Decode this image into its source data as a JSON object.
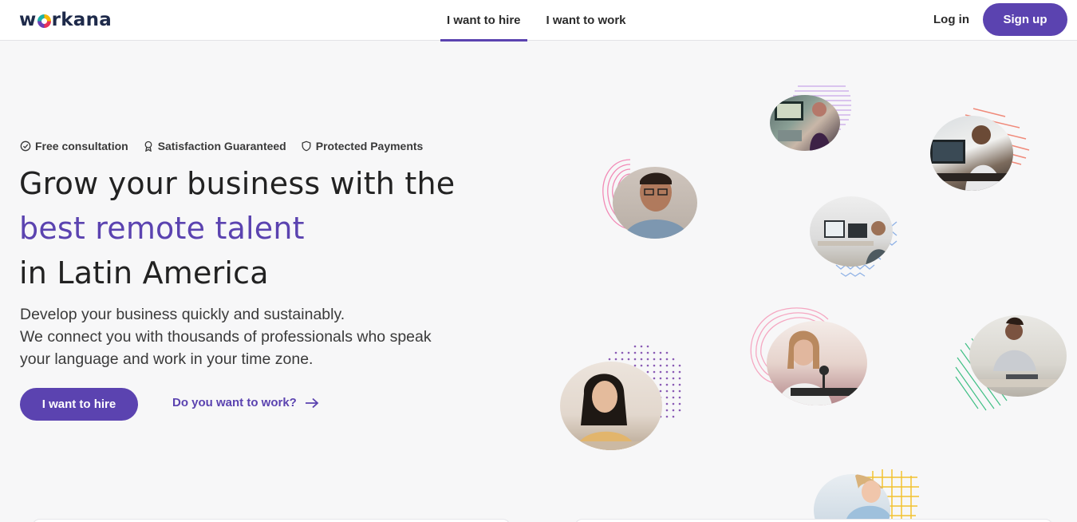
{
  "header": {
    "logo": "workana",
    "tabs": [
      {
        "label": "I want to hire",
        "active": true
      },
      {
        "label": "I want to work",
        "active": false
      }
    ],
    "login_label": "Log in",
    "signup_label": "Sign up"
  },
  "hero": {
    "badges": [
      {
        "icon": "check-circle-icon",
        "label": "Free consultation"
      },
      {
        "icon": "award-ribbon-icon",
        "label": "Satisfaction Guaranteed"
      },
      {
        "icon": "shield-icon",
        "label": "Protected Payments"
      }
    ],
    "title_line1": "Grow your business with the",
    "title_line2": "best remote talent",
    "title_line3": "in Latin America",
    "desc_line1": "Develop your business quickly and sustainably.",
    "desc_line2": "We connect you with thousands of professionals who speak",
    "desc_line3": "your language and work in your time zone.",
    "cta_primary": "I want to hire",
    "cta_secondary": "Do you want to work?"
  },
  "colors": {
    "brand_purple": "#5b43b0",
    "logo_navy": "#1e2a4a",
    "background": "#f7f7f8"
  }
}
